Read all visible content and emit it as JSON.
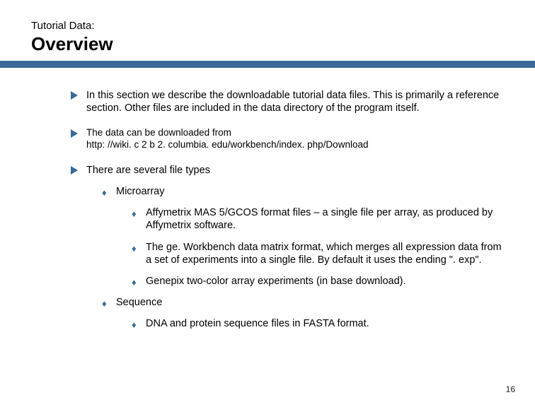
{
  "header": {
    "subtitle": "Tutorial Data:",
    "title": "Overview"
  },
  "bullets": {
    "b1": "In this section we describe the downloadable tutorial data files.  This is primarily a reference section.  Other files are included in the data directory of the program itself.",
    "b2_line1": "The data can be downloaded from",
    "b2_line2": "http: //wiki. c 2 b 2. columbia. edu/workbench/index. php/Download",
    "b3": "There are several file types",
    "b3_a": "Microarray",
    "b3_a_i": "Affymetrix MAS 5/GCOS format files – a single file per array, as produced by Affymetrix software.",
    "b3_a_ii": "The ge. Workbench data matrix format, which merges all expression data from a set of experiments into a single file.  By default it uses the ending \". exp\".",
    "b3_a_iii": "Genepix two-color array experiments (in base download).",
    "b3_b": "Sequence",
    "b3_b_i": "DNA and protein sequence files in FASTA format."
  },
  "page_number": "16",
  "glyphs": {
    "diamond": "♦"
  }
}
